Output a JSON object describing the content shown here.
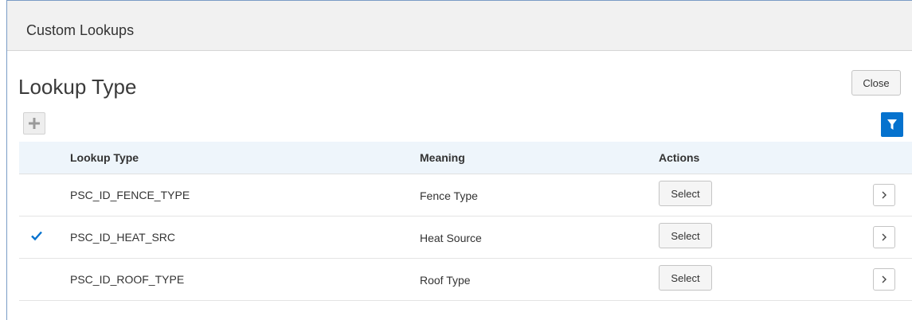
{
  "header": {
    "title": "Custom Lookups"
  },
  "page": {
    "title": "Lookup Type",
    "close_label": "Close"
  },
  "toolbar": {
    "add_icon": "plus-icon",
    "filter_icon": "filter-icon"
  },
  "table": {
    "columns": [
      "Lookup Type",
      "Meaning",
      "Actions"
    ],
    "rows": [
      {
        "selected": false,
        "lookup_type": "PSC_ID_FENCE_TYPE",
        "meaning": "Fence Type",
        "action_label": "Select"
      },
      {
        "selected": true,
        "lookup_type": "PSC_ID_HEAT_SRC",
        "meaning": "Heat Source",
        "action_label": "Select"
      },
      {
        "selected": false,
        "lookup_type": "PSC_ID_ROOF_TYPE",
        "meaning": "Roof Type",
        "action_label": "Select"
      }
    ]
  },
  "colors": {
    "accent": "#0572ce",
    "header_bg": "#f1f1f1",
    "table_header_bg": "#eef5fb"
  }
}
